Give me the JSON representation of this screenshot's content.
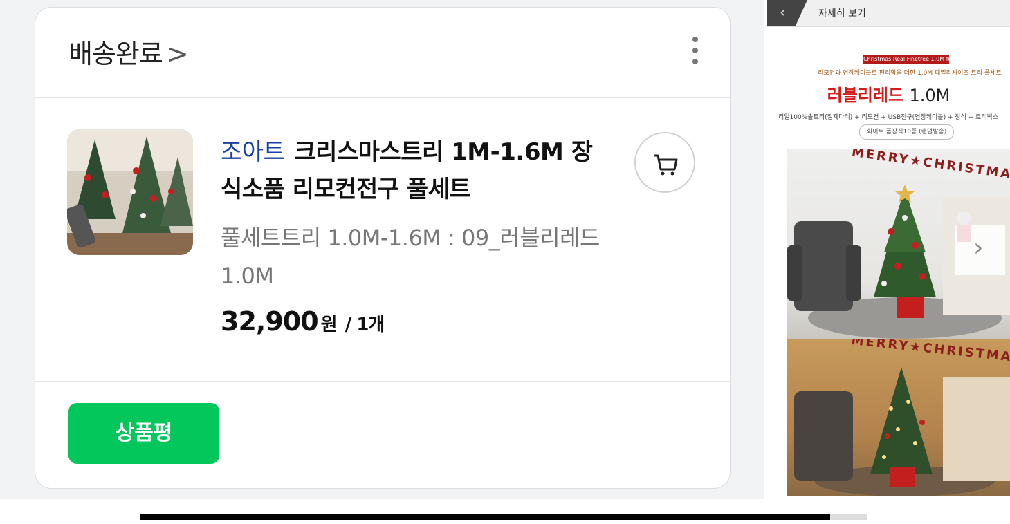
{
  "order": {
    "status": "배송완료",
    "status_chevron": ">",
    "brand": "조아트",
    "product_name": "크리스마스트리 1M-1.6M 장식소품 리모컨전구 풀세트",
    "option": "풀세트트리 1.0M-1.6M : 09_러블리레드 1.0M",
    "price": "32,900",
    "currency": "원",
    "quantity": "/ 1개",
    "review_button": "상품평"
  },
  "detail_panel": {
    "title": "자세히 보기",
    "banner": "Christmas Real Finetree 1.0M fullset",
    "subtitle": "리모컨과 연장케이블로 편리함을 더한 1.0M 패밀리사이즈 트리 풀세트",
    "name_ko": "러블리레드",
    "name_size": "1.0M",
    "components": "리얼100%솔트리(철제다리) + 리모컨 + USB전구(연장케이블) + 장식 + 트리박스",
    "badge": "화이트 폼장식10종 (랜덤발송)",
    "photo_text_1": "MERRY★CHRISTMAS",
    "photo_text_2": "MERRY★CHRISTMAS"
  },
  "icons": {
    "more": "more-vertical-icon",
    "cart": "cart-icon",
    "back": "back-icon",
    "next": "chevron-right-icon"
  },
  "colors": {
    "brand": "#1a3fa5",
    "review_button": "#03c75a",
    "panel_name": "#d21b1b"
  },
  "scrollbar": {
    "position_fraction": 0.95
  }
}
